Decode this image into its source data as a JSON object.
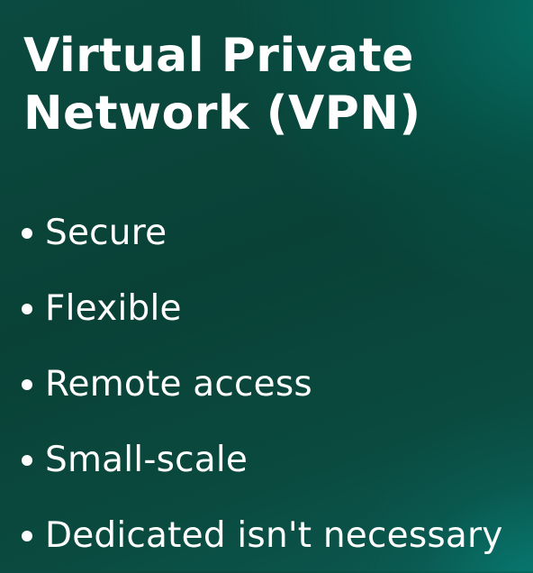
{
  "title": {
    "line1": "Virtual Private",
    "line2": "Network (VPN)"
  },
  "bullets": [
    {
      "text": "Secure"
    },
    {
      "text": "Flexible"
    },
    {
      "text": "Remote access"
    },
    {
      "text": "Small-scale"
    },
    {
      "text": "Dedicated isn't necessary"
    }
  ],
  "colors": {
    "text": "#ffffff",
    "background": "#094136",
    "accent_glow": "#009688"
  }
}
